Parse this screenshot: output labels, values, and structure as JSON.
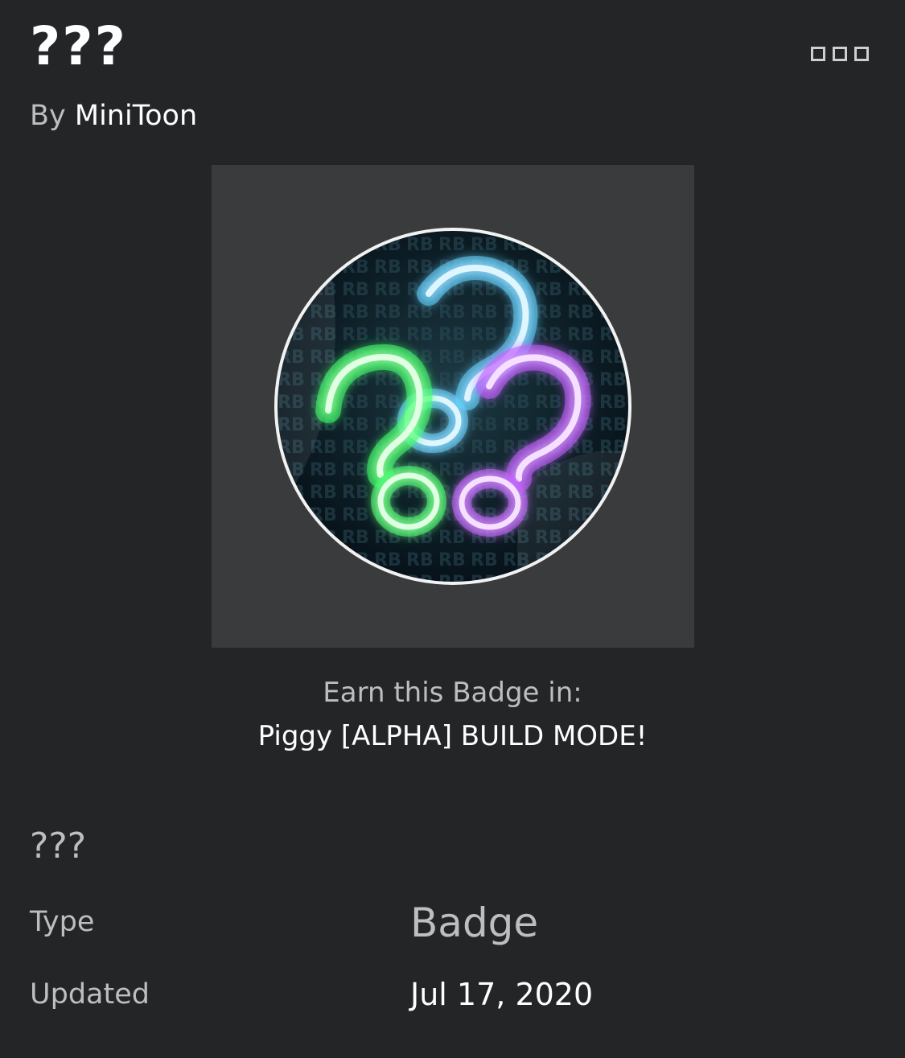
{
  "header": {
    "title": "???",
    "more_icon": "more-options-icon",
    "by_label": "By",
    "creator": "MiniToon"
  },
  "thumbnail": {
    "icon": "neon-question-marks-badge",
    "colors": {
      "frame_bg": "#393b3d",
      "green": "#7dff8a",
      "blue": "#7fd8ff",
      "purple": "#d87bff"
    }
  },
  "earn": {
    "label": "Earn this Badge in:",
    "game": "Piggy [ALPHA] BUILD MODE!"
  },
  "description": "???",
  "details": [
    {
      "label": "Type",
      "value": "Badge"
    },
    {
      "label": "Updated",
      "value": "Jul 17, 2020"
    }
  ],
  "colors": {
    "background": "#232527",
    "text_primary": "#ffffff",
    "text_secondary": "#bdbebe"
  }
}
